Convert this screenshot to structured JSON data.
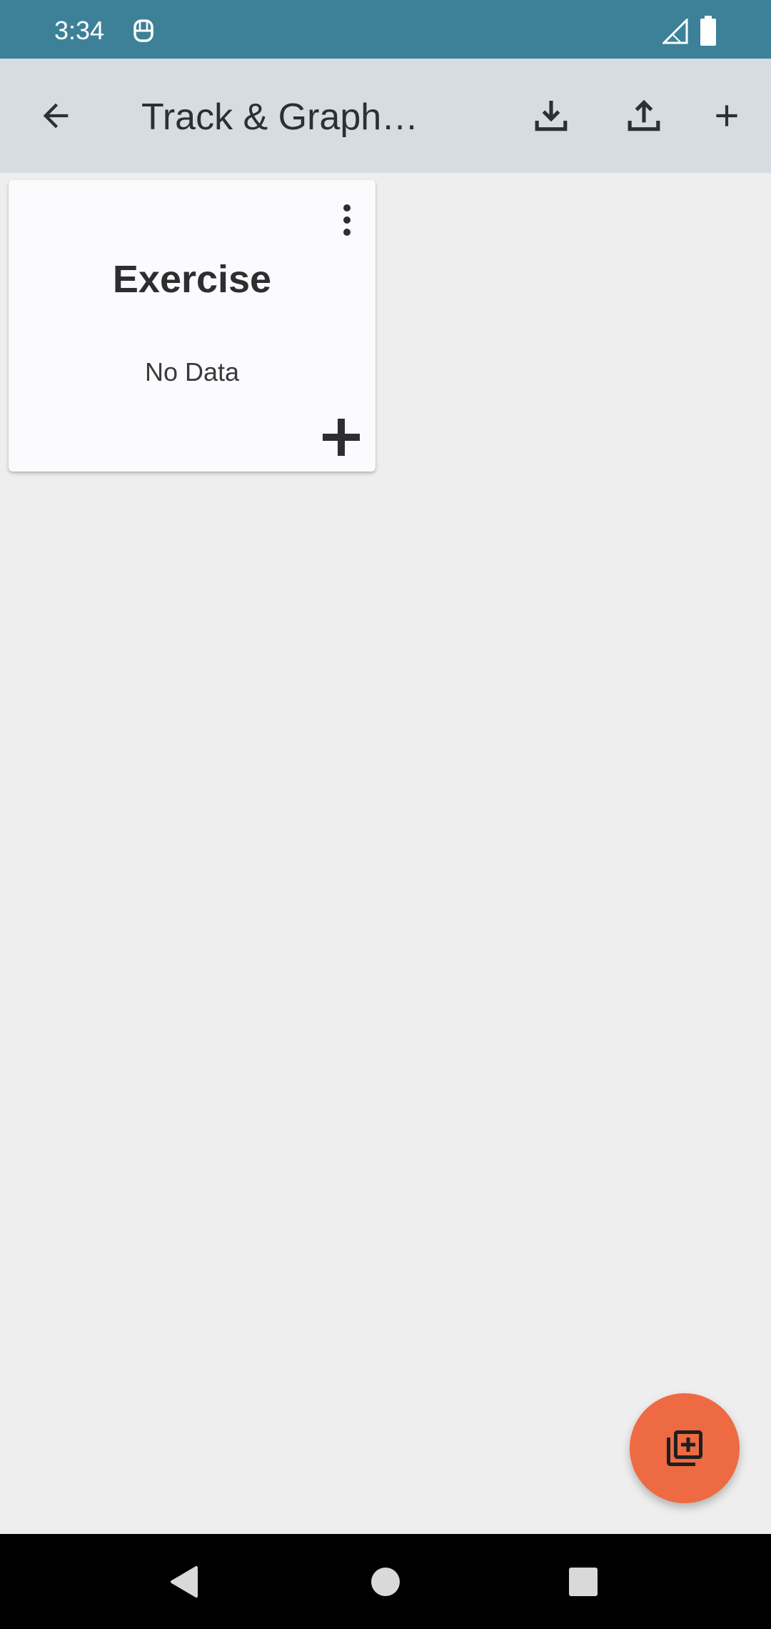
{
  "status_bar": {
    "time": "3:34",
    "icons": [
      "app-notification-icon",
      "signal-icon",
      "battery-icon"
    ]
  },
  "app_bar": {
    "title": "Track & Graph…",
    "actions": [
      "back-arrow-icon",
      "download-icon",
      "upload-icon",
      "plus-icon"
    ]
  },
  "trackers": [
    {
      "name": "Exercise",
      "status": "No Data",
      "icons": [
        "more-vertical-icon",
        "plus-icon"
      ]
    }
  ],
  "fab": {
    "icon": "add-to-library-icon",
    "color": "#ee6a42"
  },
  "colors": {
    "status_bar": "#3d8199",
    "app_bar": "#d7dce3",
    "background": "#efeeee",
    "card": "#fbfbfd"
  },
  "nav_bar": {
    "buttons": [
      "nav-back-icon",
      "nav-home-icon",
      "nav-recents-icon"
    ]
  }
}
